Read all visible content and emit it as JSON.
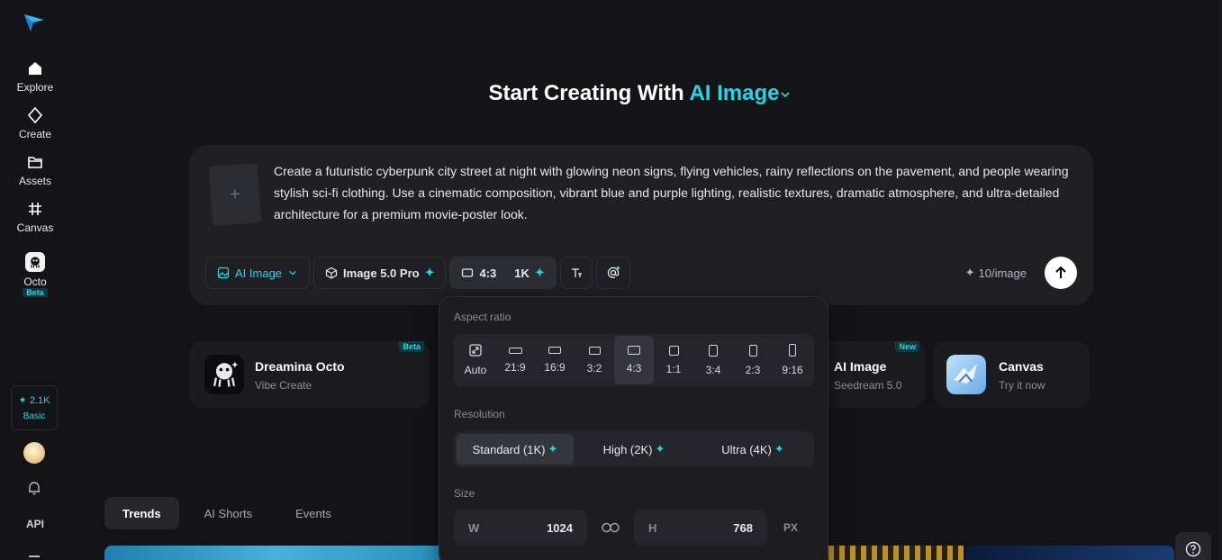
{
  "sidebar": {
    "items": [
      {
        "label": "Explore",
        "icon": "home-icon"
      },
      {
        "label": "Create",
        "icon": "diamond-icon"
      },
      {
        "label": "Assets",
        "icon": "folder-icon"
      },
      {
        "label": "Canvas",
        "icon": "grid-hash-icon"
      },
      {
        "label": "Octo",
        "icon": "octo-icon",
        "badge": "Beta"
      }
    ],
    "credits": "2.1K",
    "plan": "Basic",
    "api_label": "API"
  },
  "heading": {
    "prefix": "Start Creating With",
    "mode": "AI Image"
  },
  "prompt": {
    "text": "Create a futuristic cyberpunk city street at night with glowing neon signs, flying vehicles, rainy reflections on the pavement, and people wearing stylish sci-fi clothing. Use a cinematic composition, vibrant blue and purple lighting, realistic textures, dramatic atmosphere, and ultra-detailed architecture for a premium movie-poster look.",
    "add_symbol": "+"
  },
  "toolbar": {
    "mode_label": "AI Image",
    "model_label": "Image 5.0 Pro",
    "ratio_label": "4:3",
    "resolution_label": "1K",
    "cost_label": "10/image"
  },
  "cards": [
    {
      "title": "Dreamina Octo",
      "subtitle": "Vibe Create",
      "badge": "Beta"
    },
    {
      "title": "AI Image",
      "subtitle": "Seedream 5.0",
      "badge": "New"
    },
    {
      "title": "Canvas",
      "subtitle": "Try it now",
      "badge": ""
    }
  ],
  "tabs": [
    "Trends",
    "AI Shorts",
    "Events"
  ],
  "panel": {
    "aspect_label": "Aspect ratio",
    "ratios": [
      "Auto",
      "21:9",
      "16:9",
      "3:2",
      "4:3",
      "1:1",
      "3:4",
      "2:3",
      "9:16"
    ],
    "selected_ratio": "4:3",
    "resolution_label": "Resolution",
    "resolutions": [
      "Standard (1K)",
      "High (2K)",
      "Ultra (4K)"
    ],
    "selected_resolution": "Standard (1K)",
    "size_label": "Size",
    "width_key": "W",
    "width_value": "1024",
    "height_key": "H",
    "height_value": "768",
    "unit": "PX"
  },
  "colors": {
    "accent": "#29d3e6",
    "background": "#141418",
    "surface": "#1f1f24"
  }
}
